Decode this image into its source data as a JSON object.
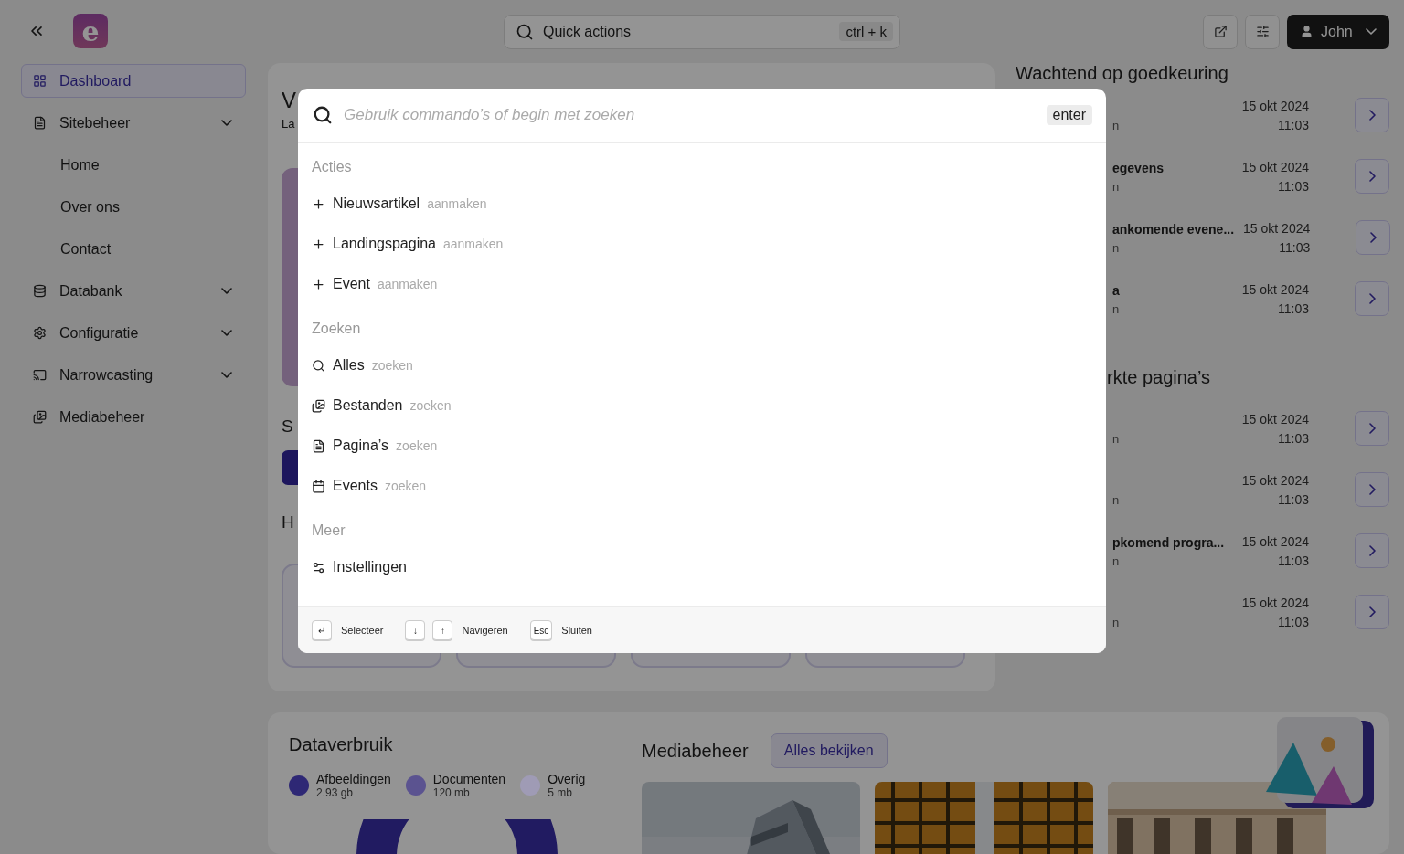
{
  "logo": "e",
  "sidebar": {
    "items": [
      {
        "label": "Dashboard",
        "selected": true,
        "kind": "link"
      },
      {
        "label": "Sitebeheer",
        "selected": false,
        "kind": "group",
        "children": [
          {
            "label": "Home",
            "selected": false
          },
          {
            "label": "Over ons",
            "selected": false
          },
          {
            "label": "Contact",
            "selected": false
          }
        ]
      },
      {
        "label": "Databank",
        "selected": false,
        "kind": "group"
      },
      {
        "label": "Configuratie",
        "selected": false,
        "kind": "group"
      },
      {
        "label": "Narrowcasting",
        "selected": false,
        "kind": "group"
      },
      {
        "label": "Mediabeheer",
        "selected": false,
        "kind": "link"
      }
    ]
  },
  "topbar": {
    "search": {
      "label": "Quick actions",
      "shortcut": "ctrl + k"
    },
    "user": "John"
  },
  "welcome_panel": {
    "heading": "V",
    "subtitle": "La",
    "section_2": "S",
    "section_3": "H"
  },
  "approval": {
    "heading": "Wachtend op goedkeuring",
    "rows": [
      {
        "subtitle": "n",
        "date": "15 okt 2024",
        "time": "11:03"
      },
      {
        "title": "egevens",
        "subtitle": "n",
        "date": "15 okt 2024",
        "time": "11:03"
      },
      {
        "title": "ankomende evene...",
        "subtitle": "n",
        "date": "15 okt 2024",
        "time": "11:03"
      },
      {
        "title": "a",
        "subtitle": "n",
        "date": "15 okt 2024",
        "time": "11:03"
      }
    ]
  },
  "edited": {
    "heading": "rkte pagina’s",
    "rows": [
      {
        "subtitle": "n",
        "date": "15 okt 2024",
        "time": "11:03"
      },
      {
        "subtitle": "n",
        "date": "15 okt 2024",
        "time": "11:03"
      },
      {
        "title": "pkomend progra...",
        "subtitle": "n",
        "date": "15 okt 2024",
        "time": "11:03"
      },
      {
        "subtitle": "n",
        "date": "15 okt 2024",
        "time": "11:03"
      }
    ]
  },
  "data_usage": {
    "title": "Dataverbruik",
    "legend": [
      {
        "label": "Afbeeldingen",
        "value": "2.93 gb",
        "color": "#2e2875"
      },
      {
        "label": "Documenten",
        "value": "120 mb",
        "color": "#5b5390"
      },
      {
        "label": "Overig",
        "value": "5 mb",
        "color": "#9f9bb5"
      }
    ]
  },
  "media": {
    "title": "Mediabeheer",
    "button": "Alles bekijken"
  },
  "command_palette": {
    "placeholder": "Gebruik commando’s of begin met zoeken",
    "enter_key": "enter",
    "sections": [
      {
        "label": "Acties",
        "items": [
          {
            "label": "Nieuwsartikel",
            "hint": "aanmaken"
          },
          {
            "label": "Landingspagina",
            "hint": "aanmaken"
          },
          {
            "label": "Event",
            "hint": "aanmaken"
          }
        ]
      },
      {
        "label": "Zoeken",
        "items": [
          {
            "label": "Alles",
            "hint": "zoeken"
          },
          {
            "label": "Bestanden",
            "hint": "zoeken"
          },
          {
            "label": "Pagina’s",
            "hint": "zoeken"
          },
          {
            "label": "Events",
            "hint": "zoeken"
          }
        ]
      },
      {
        "label": "Meer",
        "items": [
          {
            "label": "Instellingen"
          }
        ]
      }
    ],
    "footer": [
      {
        "keys": [
          "↵"
        ],
        "label": "Selecteer"
      },
      {
        "keys": [
          "↓",
          "↑"
        ],
        "label": "Navigeren"
      },
      {
        "keys": [
          "Esc"
        ],
        "label": "Sluiten"
      }
    ]
  }
}
